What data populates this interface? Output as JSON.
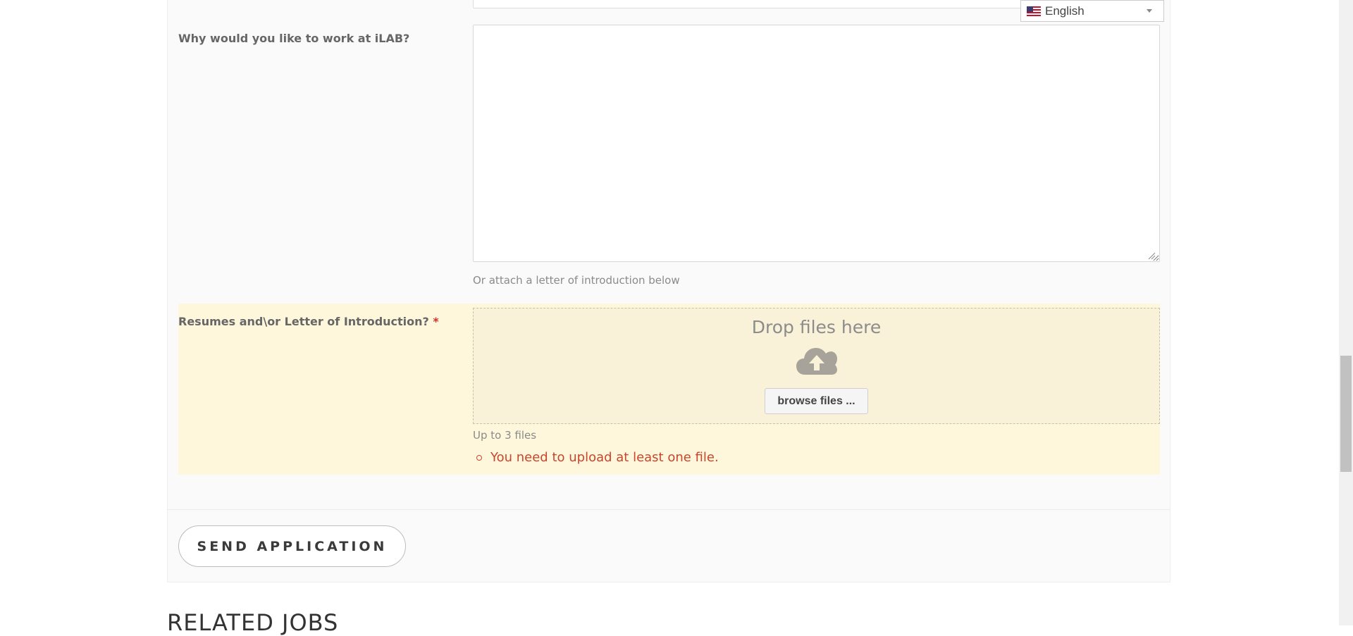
{
  "language_selector": {
    "label": "English",
    "flag_icon": "us-flag-icon"
  },
  "form": {
    "why_label": "Why would you like to work at iLAB?",
    "why_value": "",
    "hint": "Or attach a letter of introduction below",
    "resume_label": "Resumes and\\or Letter of Introduction?",
    "required_marker": "*",
    "dropzone": {
      "title": "Drop files here",
      "icon": "cloud-upload-icon",
      "browse_label": "browse files ..."
    },
    "file_limit": "Up to 3 files",
    "errors": [
      "You need to upload at least one file."
    ],
    "submit_label": "SEND APPLICATION"
  },
  "related_heading": "RELATED JOBS",
  "colors": {
    "error_text": "#c9452b",
    "error_bg": "#fff7dc",
    "required": "#d0312d"
  }
}
